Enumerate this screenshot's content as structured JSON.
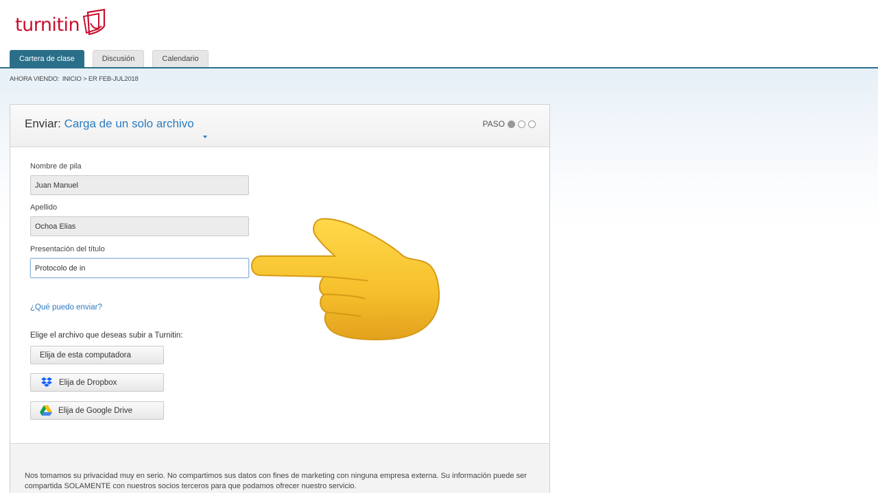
{
  "brand": {
    "name": "turnitin"
  },
  "tabs": [
    {
      "label": "Cartera de clase",
      "active": true
    },
    {
      "label": "Discusión",
      "active": false
    },
    {
      "label": "Calendario",
      "active": false
    }
  ],
  "breadcrumb": {
    "now_viewing": "AHORA VIENDO:",
    "path": "INICIO > ER FEB-JUL2018"
  },
  "card": {
    "title_prefix": "Enviar:",
    "title_mode": "Carga de un solo archivo",
    "step_label": "PASO",
    "step_current": 1,
    "step_total": 3
  },
  "form": {
    "first_name_label": "Nombre de pila",
    "first_name_value": "Juan Manuel",
    "last_name_label": "Apellido",
    "last_name_value": "Ochoa Elias",
    "title_label": "Presentación del título",
    "title_value": "Protocolo de in",
    "help_link": "¿Qué puedo enviar?",
    "choose_label": "Elige el archivo que deseas subir a Turnitin:",
    "buttons": {
      "computer": "Elija de esta computadora",
      "dropbox": "Elija de Dropbox",
      "drive": "Elija de Google Drive"
    }
  },
  "footer": {
    "privacy": "Nos tomamos su privacidad muy en serio. No compartimos sus datos con fines de marketing con ninguna empresa externa. Su información puede ser compartida SOLAMENTE con nuestros socios terceros para que podamos ofrecer nuestro servicio."
  },
  "colors": {
    "brand_red": "#c8102e",
    "tab_active": "#2a6f89",
    "link_blue": "#2b7bc0",
    "dropbox_blue": "#0d61fe"
  },
  "overlay": {
    "icon": "pointing-hand-emoji-icon"
  }
}
